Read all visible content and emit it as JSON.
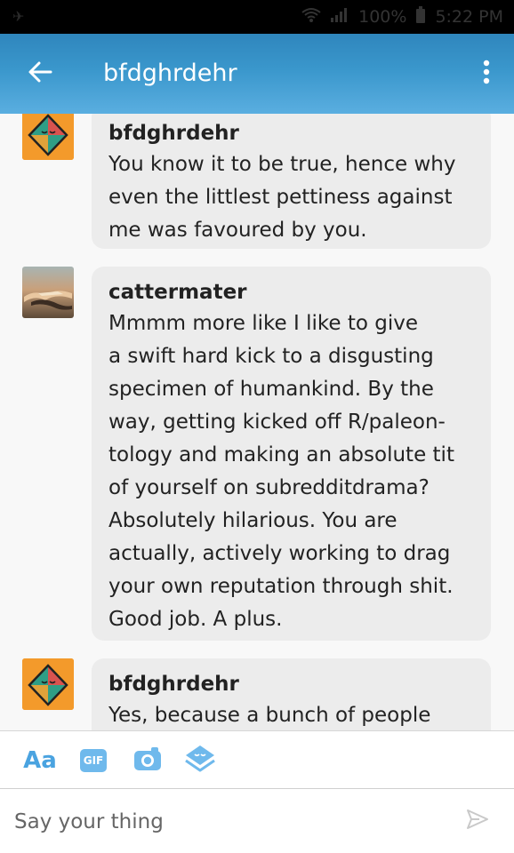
{
  "status_bar": {
    "battery": "100%",
    "time": "5:22 PM"
  },
  "app_bar": {
    "title": "bfdghrdehr"
  },
  "messages": [
    {
      "author": "bfdghrdehr",
      "text": "You know it to be true, hence why\neven the littlest pettiness against\nme was favoured by you."
    },
    {
      "author": "cattermater",
      "text": "Mmmm more like I like to give\na swift hard kick to a disgusting\nspecimen of humankind. By the\nway, getting kicked off R/paleon-\ntology and making an absolute tit\nof yourself on subredditdrama?\nAbsolutely hilarious. You are\nactually, actively working to drag\nyour own reputation through shit.\nGood job. A plus."
    },
    {
      "author": "bfdghrdehr",
      "text": "Yes, because a bunch of people"
    }
  ],
  "composer": {
    "text_style_label": "Aa",
    "gif_label": "GIF",
    "placeholder": "Say your thing"
  },
  "colors": {
    "app_bar": "#3a97cc",
    "accent": "#4aa3e0",
    "bubble": "#ececec",
    "avatar_bg": "#f39a2b"
  },
  "icons": [
    "back-arrow-icon",
    "more-vertical-icon",
    "camera-icon",
    "sticker-icon",
    "send-icon"
  ]
}
